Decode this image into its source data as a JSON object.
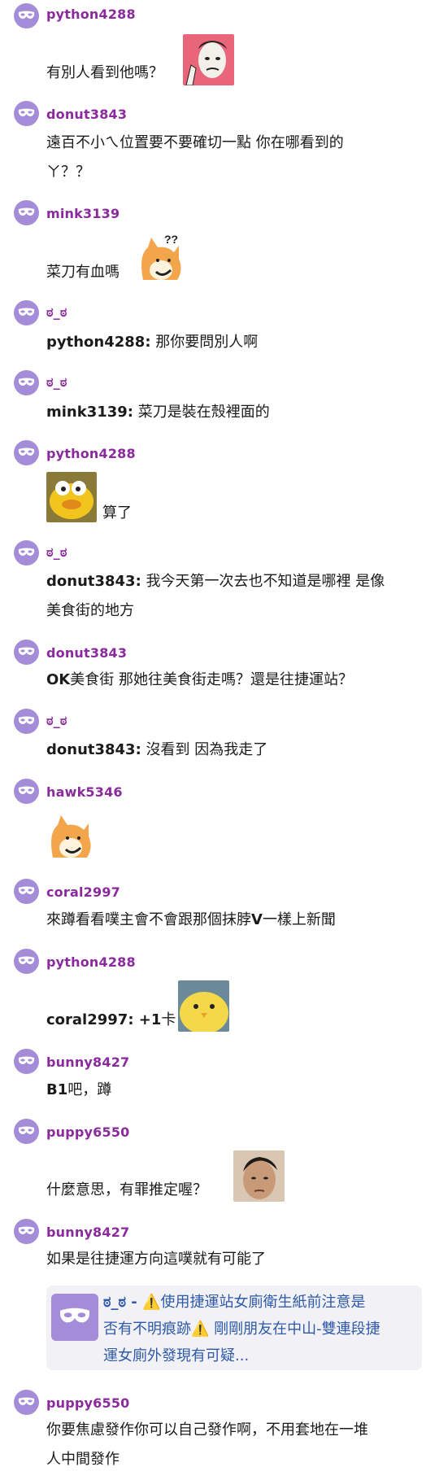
{
  "colors": {
    "username": "#8a2a9d",
    "avatar": "#a48cd8",
    "link": "#2e5aa8",
    "quote_bg": "#f1f1f6"
  },
  "messages": [
    {
      "user": "python4288",
      "text": "有別人看到他嗎？"
    },
    {
      "user": "donut3843",
      "line1": "遠百不小ㄟ位置要不要確切一點 你在哪看到的",
      "line2": "ㄚ？？"
    },
    {
      "user": "mink3139",
      "text": "菜刀有血嗎"
    },
    {
      "user": "ಠ_ಠ",
      "reply_user": "python4288:",
      "text": " 那你要問別人啊"
    },
    {
      "user": "ಠ_ಠ",
      "reply_user": "mink3139:",
      "text": " 菜刀是裝在殼裡面的"
    },
    {
      "user": "python4288",
      "text": "算了"
    },
    {
      "user": "ಠ_ಠ",
      "reply_user": "donut3843:",
      "line1": " 我今天第一次去也不知道是哪裡 是像",
      "line2": "美食街的地方"
    },
    {
      "user": "donut3843",
      "bold": "OK",
      "text": "美食街 那她往美食街走嗎？還是往捷運站？"
    },
    {
      "user": "ಠ_ಠ",
      "reply_user": "donut3843:",
      "text": " 沒看到 因為我走了"
    },
    {
      "user": "hawk5346"
    },
    {
      "user": "coral2997",
      "pre": "來蹲看看噗主會不會跟那個抹脖",
      "bold": "V",
      "post": "一樣上新聞"
    },
    {
      "user": "python4288",
      "reply_user": "coral2997: +1",
      "text": "卡"
    },
    {
      "user": "bunny8427",
      "bold": "B1",
      "text": "吧，蹲"
    },
    {
      "user": "puppy6550",
      "text": "什麼意思，有罪推定喔？"
    },
    {
      "user": "bunny8427",
      "text": "如果是往捷運方向這噗就有可能了",
      "quote": {
        "prefix": "ಠ_ಠ - ",
        "warn1": "⚠️",
        "line1": "使用捷運站女廁衛生紙前注意是",
        "line2a": "否有不明痕跡",
        "warn2": "⚠️",
        "line2b": " 剛剛朋友在中山-雙連段捷",
        "line3": "運女廁外發現有可疑..."
      }
    },
    {
      "user": "puppy6550",
      "line1": "你要焦慮發作你可以自己發作啊，不用套地在一堆",
      "line2": "人中間發作"
    }
  ]
}
